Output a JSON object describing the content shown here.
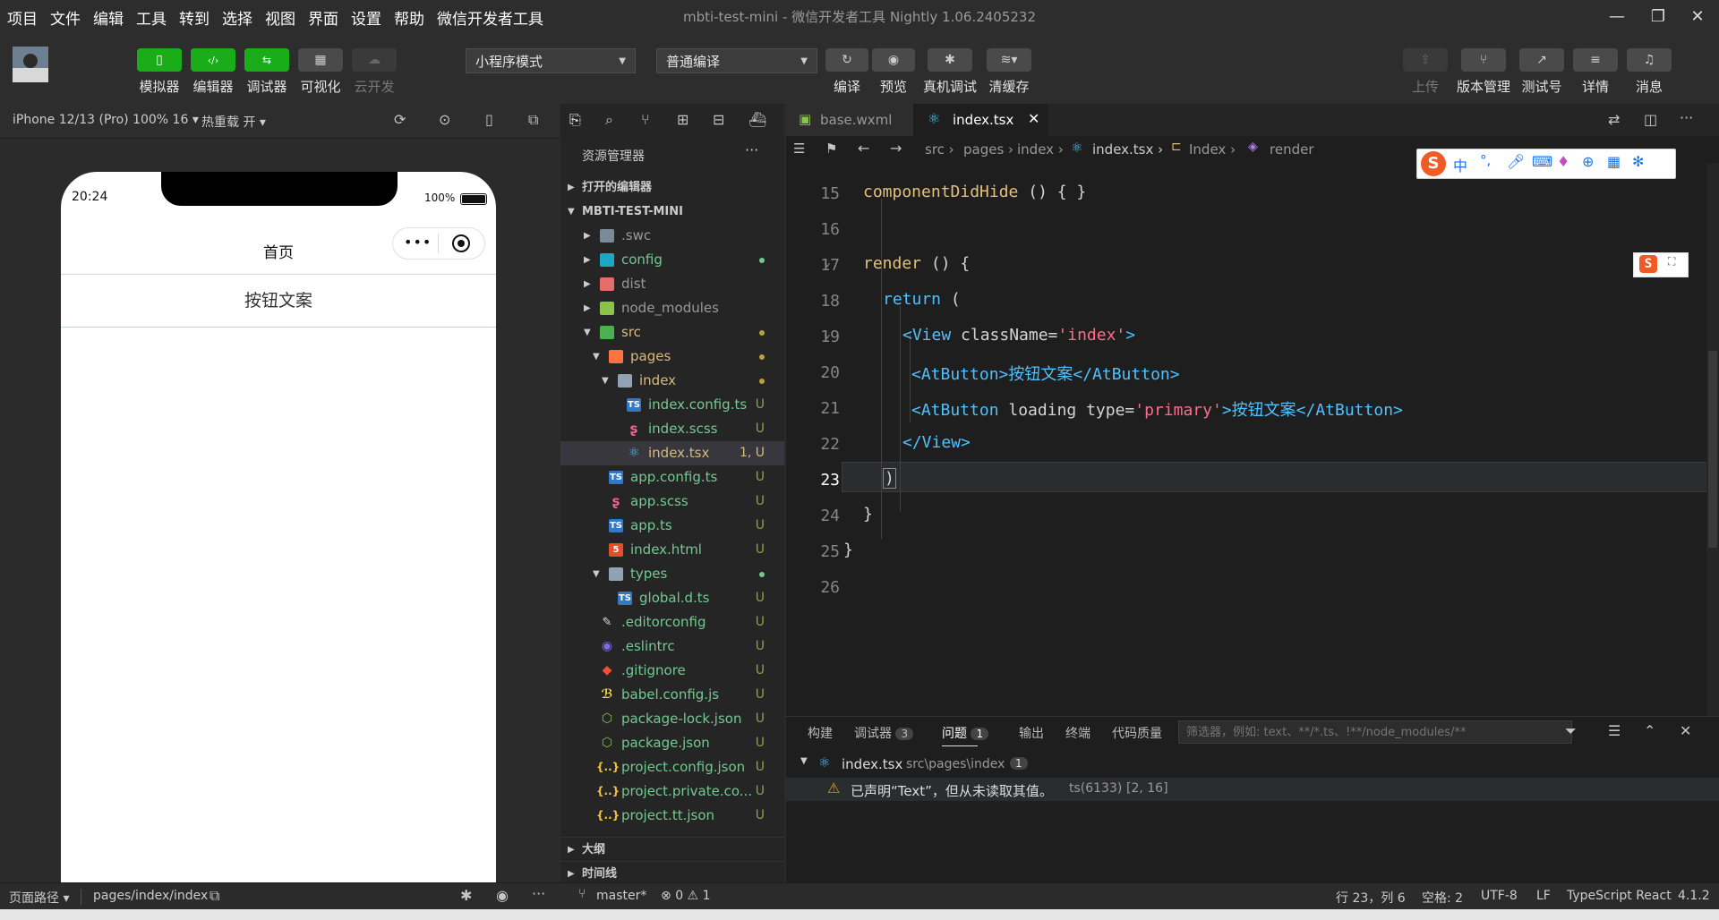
{
  "menu": [
    "项目",
    "文件",
    "编辑",
    "工具",
    "转到",
    "选择",
    "视图",
    "界面",
    "设置",
    "帮助",
    "微信开发者工具"
  ],
  "window_title": "mbti-test-mini - 微信开发者工具 Nightly 1.06.2405232",
  "toolbar": {
    "simulator": "模拟器",
    "editor": "编辑器",
    "debugger": "调试器",
    "visual": "可视化",
    "cloud": "云开发",
    "mode_select": "小程序模式",
    "compile_select": "普通编译",
    "compile": "编译",
    "preview": "预览",
    "remote_debug": "真机调试",
    "clear_cache": "清缓存",
    "upload": "上传",
    "version": "版本管理",
    "test": "测试号",
    "detail": "详情",
    "message": "消息"
  },
  "simulator": {
    "device": "iPhone 12/13 (Pro) 100% 16",
    "hot_reload": "热重载 开",
    "time": "20:24",
    "battery": "100%",
    "nav_title": "首页",
    "button_text": "按钮文案"
  },
  "explorer": {
    "title": "资源管理器",
    "open_editors": "打开的编辑器",
    "project": "MBTI-TEST-MINI",
    "items": [
      {
        "label": ".swc",
        "status": ""
      },
      {
        "label": "config",
        "status": ""
      },
      {
        "label": "dist",
        "status": ""
      },
      {
        "label": "node_modules",
        "status": ""
      },
      {
        "label": "src",
        "status": ""
      },
      {
        "label": "pages",
        "status": ""
      },
      {
        "label": "index",
        "status": ""
      },
      {
        "label": "index.config.ts",
        "status": "U"
      },
      {
        "label": "index.scss",
        "status": "U"
      },
      {
        "label": "index.tsx",
        "status": "1, U"
      },
      {
        "label": "app.config.ts",
        "status": "U"
      },
      {
        "label": "app.scss",
        "status": "U"
      },
      {
        "label": "app.ts",
        "status": "U"
      },
      {
        "label": "index.html",
        "status": "U"
      },
      {
        "label": "types",
        "status": ""
      },
      {
        "label": "global.d.ts",
        "status": "U"
      },
      {
        "label": ".editorconfig",
        "status": "U"
      },
      {
        "label": ".eslintrc",
        "status": "U"
      },
      {
        "label": ".gitignore",
        "status": "U"
      },
      {
        "label": "babel.config.js",
        "status": "U"
      },
      {
        "label": "package-lock.json",
        "status": "U"
      },
      {
        "label": "package.json",
        "status": "U"
      },
      {
        "label": "project.config.json",
        "status": "U"
      },
      {
        "label": "project.private.co...",
        "status": "U"
      },
      {
        "label": "project.tt.json",
        "status": "U"
      }
    ],
    "outline": "大纲",
    "timeline": "时间线"
  },
  "tabs": {
    "t1": "base.wxml",
    "t2": "index.tsx"
  },
  "breadcrumb": {
    "b1": "src",
    "b2": "pages",
    "b3": "index",
    "b4": "index.tsx",
    "b5": "Index",
    "b6": "render"
  },
  "editor": {
    "lines": [
      "15",
      "16",
      "17",
      "18",
      "19",
      "20",
      "21",
      "22",
      "23",
      "24",
      "25",
      "26"
    ],
    "c15a": "componentDidHide",
    "c15b": " () { }",
    "c17a": "render",
    "c17b": " () {",
    "c18a": "return",
    "c18b": " (",
    "c19a": "<View",
    "c19b": " className=",
    "c19c": "'index'",
    "c19d": ">",
    "c20a": "<AtButton>",
    "c20b": "按钮文案",
    "c20c": "</AtButton>",
    "c21a": "<AtButton",
    "c21b": " loading type=",
    "c21c": "'primary'",
    "c21d": ">",
    "c21e": "按钮文案",
    "c21f": "</AtButton>",
    "c22": "</View>",
    "c23": ")",
    "c24": "}",
    "c25": "}"
  },
  "ime": {
    "lang": "中"
  },
  "panel": {
    "build": "构建",
    "debugger": "调试器",
    "debugger_count": "3",
    "problems": "问题",
    "problems_count": "1",
    "output": "输出",
    "terminal": "终端",
    "quality": "代码质量",
    "filter_placeholder": "筛选器，例如: text、**/*.ts、!**/node_modules/**",
    "file": "index.tsx",
    "path": "src\\pages\\index",
    "file_count": "1",
    "message": "已声明“Text”，但从未读取其值。",
    "code": "ts(6133)",
    "pos": "[2, 16]"
  },
  "status": {
    "page_path": "页面路径",
    "path": "pages/index/index",
    "branch": "master*",
    "errors": "0",
    "warnings": "1",
    "cursor": "行 23，列 6",
    "spaces": "空格: 2",
    "encoding": "UTF-8",
    "eol": "LF",
    "lang": "TypeScript React",
    "version": "4.1.2"
  },
  "colors": {
    "green": "#1aad19",
    "accent": "#e5c07b",
    "keyword": "#c586c0"
  }
}
